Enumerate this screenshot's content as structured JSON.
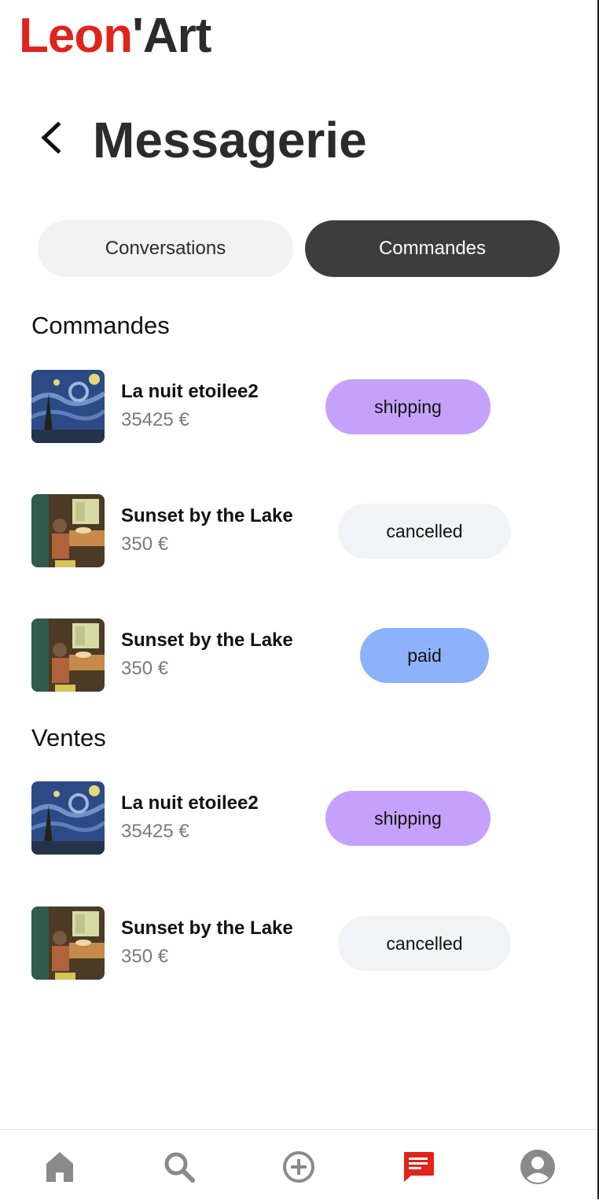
{
  "app": {
    "logo_part1": "Leon",
    "logo_part2": "'Art"
  },
  "header": {
    "title": "Messagerie"
  },
  "tabs": [
    {
      "label": "Conversations",
      "active": false
    },
    {
      "label": "Commandes",
      "active": true
    }
  ],
  "orders_section": {
    "title": "Commandes",
    "items": [
      {
        "name": "La nuit etoilee2",
        "price": "35425 €",
        "status": "shipping",
        "thumb": "starry-night"
      },
      {
        "name": "Sunset by the Lake",
        "price": "350 €",
        "status": "cancelled",
        "thumb": "sunset-room"
      },
      {
        "name": "Sunset by the Lake",
        "price": "350 €",
        "status": "paid",
        "thumb": "sunset-room"
      }
    ]
  },
  "sales_section": {
    "title": "Ventes",
    "items": [
      {
        "name": "La nuit etoilee2",
        "price": "35425 €",
        "status": "shipping",
        "thumb": "starry-night"
      },
      {
        "name": "Sunset by the Lake",
        "price": "350 €",
        "status": "cancelled",
        "thumb": "sunset-room"
      }
    ]
  },
  "status_colors": {
    "shipping": "#c6a1fb",
    "cancelled": "#f2f3f6",
    "paid": "#8cb2fb"
  },
  "navbar": [
    {
      "icon": "home-icon",
      "active": false
    },
    {
      "icon": "search-icon",
      "active": false
    },
    {
      "icon": "add-circle-icon",
      "active": false
    },
    {
      "icon": "chat-icon",
      "active": true
    },
    {
      "icon": "account-icon",
      "active": false
    }
  ],
  "colors": {
    "brand_red": "#e0241b",
    "dark": "#3d3d3d",
    "inactive_icon": "#8a8a8a"
  }
}
